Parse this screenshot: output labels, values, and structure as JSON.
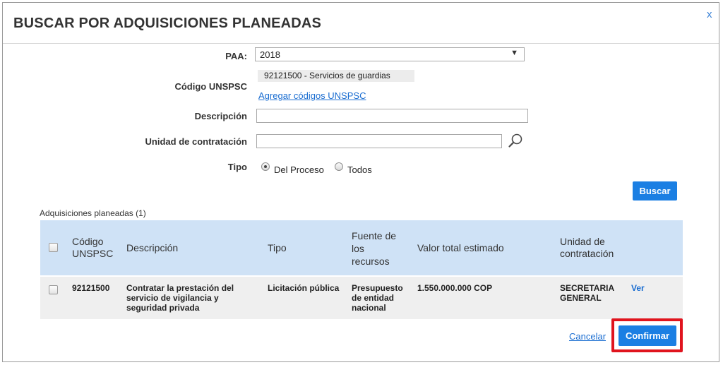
{
  "dialog": {
    "title": "BUSCAR POR ADQUISICIONES PLANEADAS",
    "close_label": "x"
  },
  "form": {
    "paa_label": "PAA:",
    "paa_value": "2018",
    "unspsc_label": "Código UNSPSC",
    "unspsc_tag": "92121500 - Servicios de guardias",
    "add_unspsc_link": "Agregar códigos UNSPSC",
    "descripcion_label": "Descripción",
    "descripcion_value": "",
    "unidad_label": "Unidad de contratación",
    "unidad_value": "",
    "tipo_label": "Tipo",
    "tipo_options": [
      "Del Proceso",
      "Todos"
    ],
    "tipo_selected": "Del Proceso",
    "search_button": "Buscar"
  },
  "results": {
    "section_title": "Adquisiciones planeadas (1)",
    "columns": {
      "codigo": [
        "Código",
        "UNSPSC"
      ],
      "descripcion": "Descripción",
      "tipo": "Tipo",
      "fuente": [
        "Fuente de",
        "los",
        "recursos"
      ],
      "valor": "Valor total estimado",
      "unidad": [
        "Unidad de",
        "contratación"
      ]
    },
    "rows": [
      {
        "codigo": "92121500",
        "descripcion": [
          "Contratar la prestación del",
          "servicio de vigilancia y",
          "seguridad privada"
        ],
        "tipo": "Licitación pública",
        "fuente": [
          "Presupuesto",
          "de entidad",
          "nacional"
        ],
        "valor": "1.550.000.000 COP",
        "unidad": [
          "SECRETARIA",
          "GENERAL"
        ],
        "ver_link": "Ver"
      }
    ]
  },
  "footer": {
    "cancel_link": "Cancelar",
    "confirm_button": "Confirmar"
  },
  "colors": {
    "accent": "#1b7fe3",
    "header_bg": "#cfe2f6",
    "row_bg": "#efefef",
    "highlight": "#e0141e",
    "link": "#1a6dd1"
  }
}
